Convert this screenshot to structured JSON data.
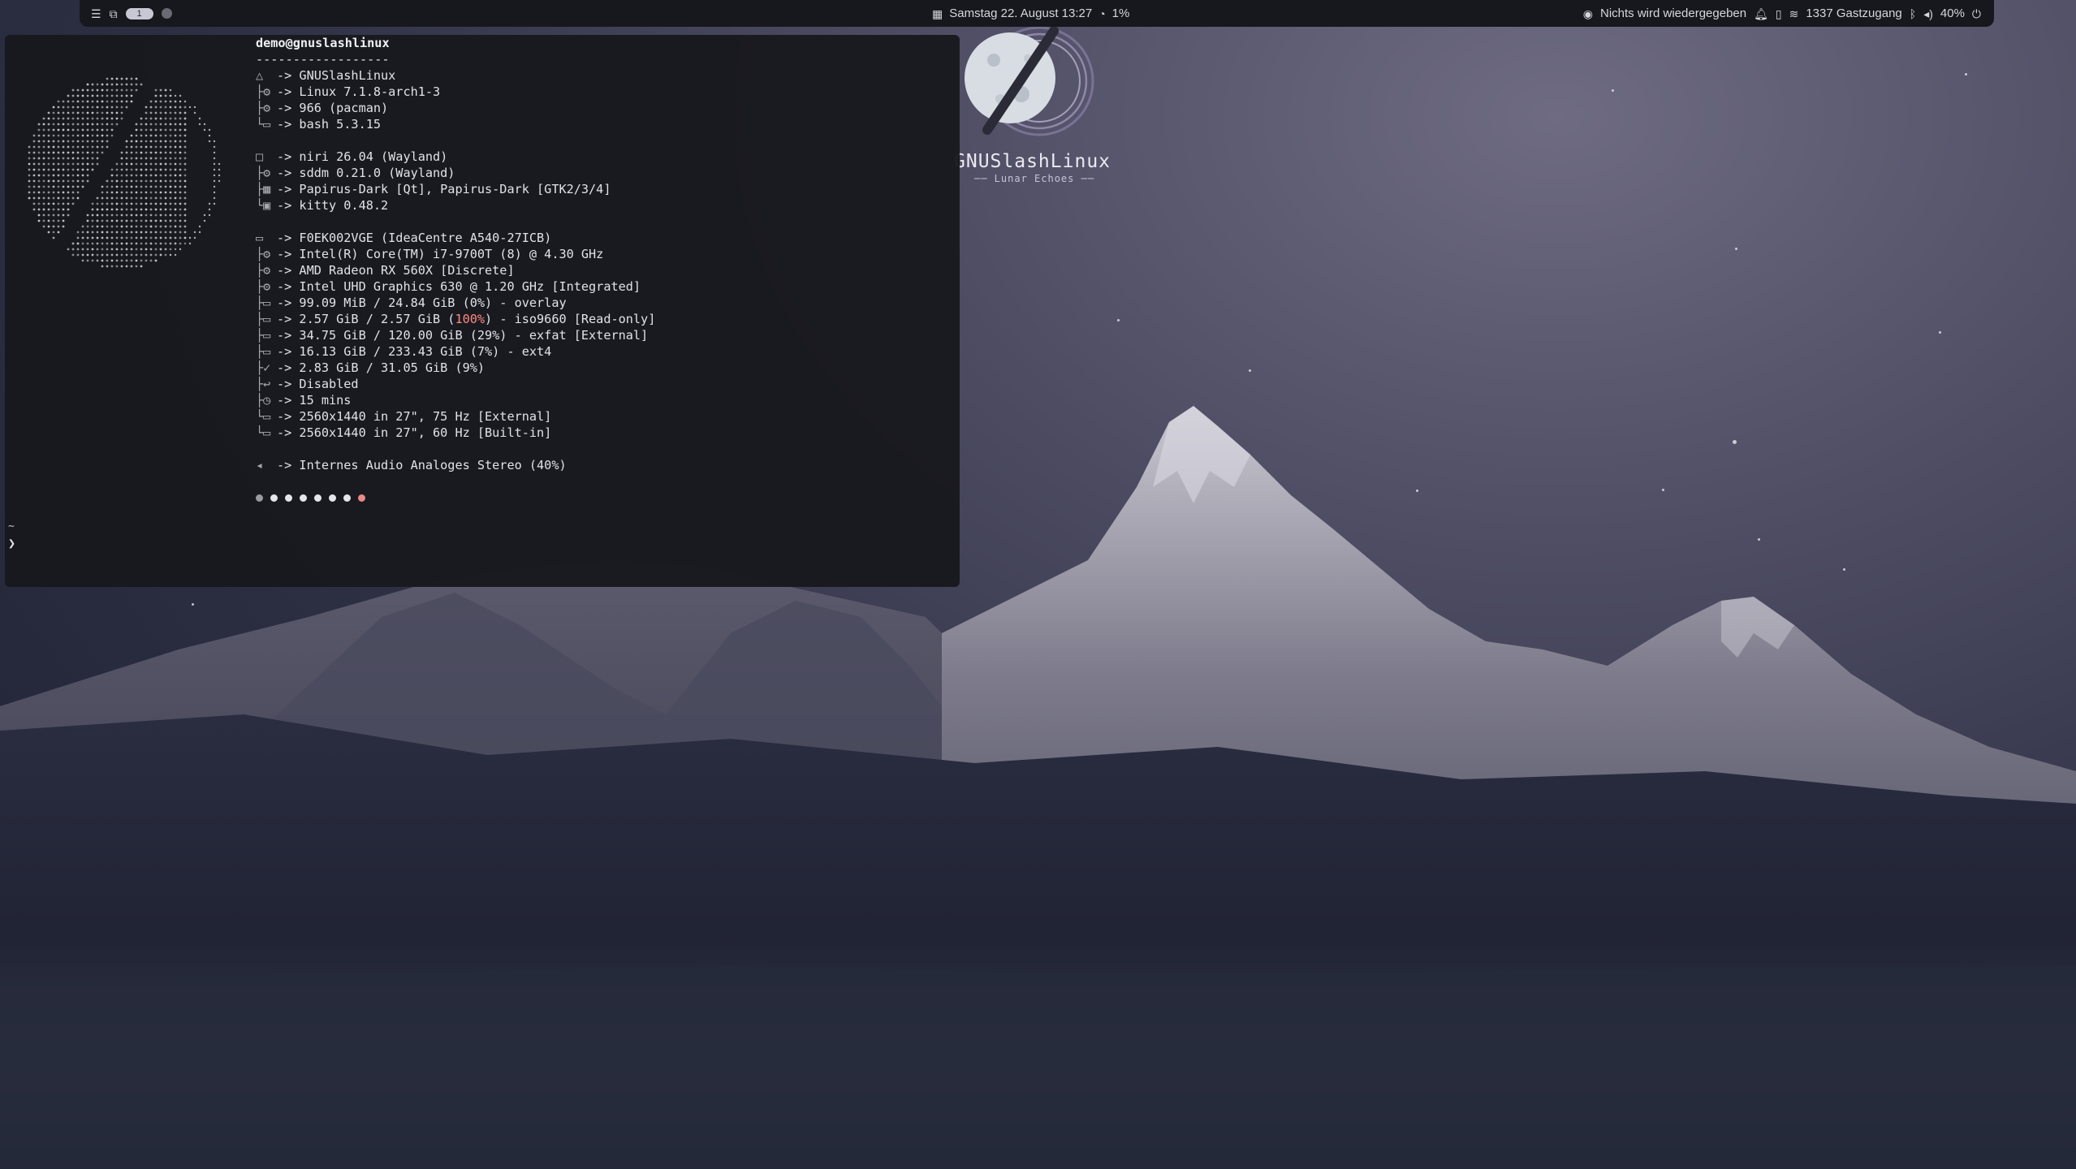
{
  "topbar": {
    "workspace_label": "1",
    "datetime": "Samstag 22. August 13:27",
    "cpu_usage": "1%",
    "media_status": "Nichts wird wiedergegeben",
    "wifi_network": "1337 Gastzugang",
    "volume": "40%",
    "icons": [
      "menu-icon",
      "window-overview-icon",
      "calendar-icon",
      "cpu-gauge-icon",
      "media-player-icon",
      "bell-icon",
      "clipboard-icon",
      "wifi-icon",
      "bluetooth-icon",
      "volume-icon",
      "power-icon"
    ]
  },
  "terminal": {
    "header": "demo@gnuslashlinux",
    "separator": "------------------",
    "lines": {
      "os": "-> GNUSlashLinux",
      "kernel": "-> Linux 7.1.8-arch1-3",
      "packages": "-> 966 (pacman)",
      "shell": "-> bash 5.3.15",
      "wm": "-> niri 26.04 (Wayland)",
      "lm": "-> sddm 0.21.0 (Wayland)",
      "icons": "-> Papirus-Dark [Qt], Papirus-Dark [GTK2/3/4]",
      "terminal": "-> kitty 0.48.2",
      "host": "-> F0EK002VGE (IdeaCentre A540-27ICB)",
      "cpu": "-> Intel(R) Core(TM) i7-9700T (8) @ 4.30 GHz",
      "gpu1": "-> AMD Radeon RX 560X [Discrete]",
      "gpu2": "-> Intel UHD Graphics 630 @ 1.20 GHz [Integrated]",
      "disk1": "-> 99.09 MiB / 24.84 GiB (0%) - overlay",
      "disk2_pre": "-> 2.57 GiB / 2.57 GiB (",
      "disk2_pct": "100%",
      "disk2_post": ") - iso9660 [Read-only]",
      "disk3": "-> 34.75 GiB / 120.00 GiB (29%) - exfat [External]",
      "disk4": "-> 16.13 GiB / 233.43 GiB (7%) - ext4",
      "memory": "-> 2.83 GiB / 31.05 GiB (9%)",
      "swap": "-> Disabled",
      "uptime": "-> 15 mins",
      "display1": "-> 2560x1440 in 27\", 75 Hz [External]",
      "display2": "-> 2560x1440 in 27\", 60 Hz [Built-in]",
      "sound": "-> Internes Audio Analoges Stereo (40%)"
    },
    "color_dots": [
      "#9a9aa2",
      "#e6e6ea",
      "#e6e6ea",
      "#e6e6ea",
      "#e6e6ea",
      "#e6e6ea",
      "#e6e6ea",
      "#e88a86"
    ],
    "prompt_dir": "~",
    "prompt_symbol": "❯"
  },
  "desktop_logo": {
    "name": "GNUSlashLinux",
    "tagline": "── Lunar Echoes ──"
  }
}
